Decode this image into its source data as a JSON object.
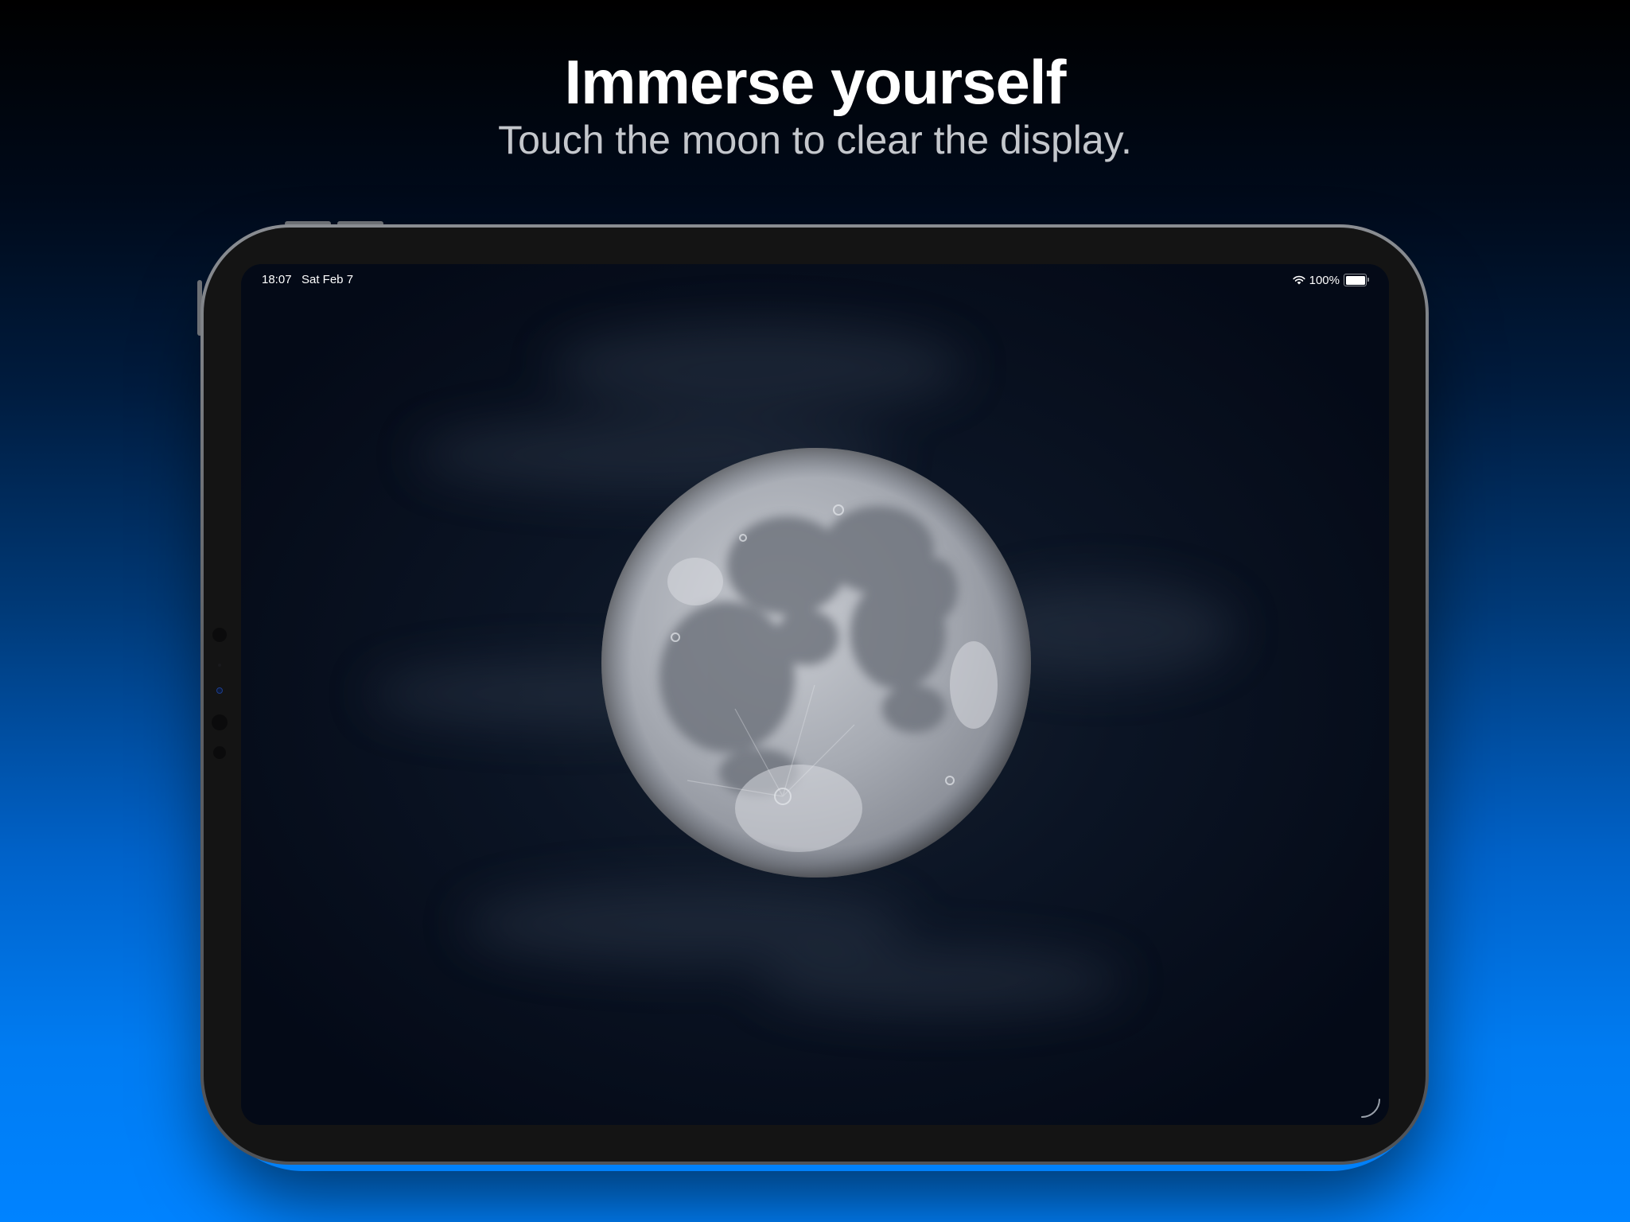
{
  "promo": {
    "headline": "Immerse yourself",
    "subline": "Touch the moon to clear the display."
  },
  "status_bar": {
    "time": "18:07",
    "date": "Sat Feb 7",
    "battery_text": "100%",
    "battery_level": 1.0,
    "icons": [
      "wifi-icon",
      "battery-icon"
    ]
  },
  "screen": {
    "main_object": "moon",
    "corner_icon": "corner-arc-icon"
  },
  "colors": {
    "background_top": "#000000",
    "background_bottom": "#0083ff",
    "screen_bg": "#050c1a",
    "headline": "#ffffff",
    "subline": "#c4c7cc"
  }
}
